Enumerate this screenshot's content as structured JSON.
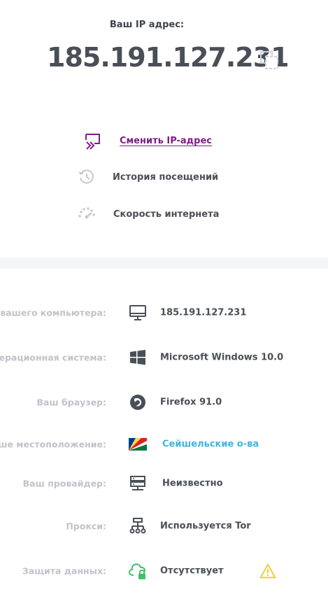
{
  "header": {
    "caption": "Ваш IP адрес:",
    "ip": "185.191.127.231"
  },
  "actions": {
    "change_ip": "Сменить IP-адрес",
    "history": "История посещений",
    "speed": "Скорость интернета"
  },
  "details": {
    "ip": {
      "label": "IP вашего компьютера:",
      "value": "185.191.127.231"
    },
    "os": {
      "label": "Операционная система:",
      "value": "Microsoft Windows 10.0"
    },
    "browser": {
      "label": "Ваш браузер:",
      "value": "Firefox 91.0"
    },
    "location": {
      "label": "Ваше местоположение:",
      "value": "Сейшельские о-ва"
    },
    "provider": {
      "label": "Ваш провайдер:",
      "value": "Неизвестно"
    },
    "proxy": {
      "label": "Прокси:",
      "value": "Используется Tor"
    },
    "protection": {
      "label": "Защита данных:",
      "value": "Отсутствует"
    }
  },
  "colors": {
    "accent_purple": "#7b1f86",
    "link_blue": "#40b4de",
    "label_grey": "#bfc3c9",
    "text_dark": "#4a4f57",
    "warning_yellow": "#e8d23a",
    "cloud_green": "#3cc46a"
  },
  "icons": {
    "copy": "copy-icon",
    "change_ip": "switch-ip-icon",
    "history": "history-clock-icon",
    "speed": "speedometer-icon",
    "ip": "monitor-icon",
    "os": "windows-logo-icon",
    "browser": "firefox-icon",
    "location": "seychelles-flag-icon",
    "provider": "server-icon",
    "proxy": "network-icon",
    "protection": "cloud-lock-icon",
    "warning": "warning-icon"
  }
}
